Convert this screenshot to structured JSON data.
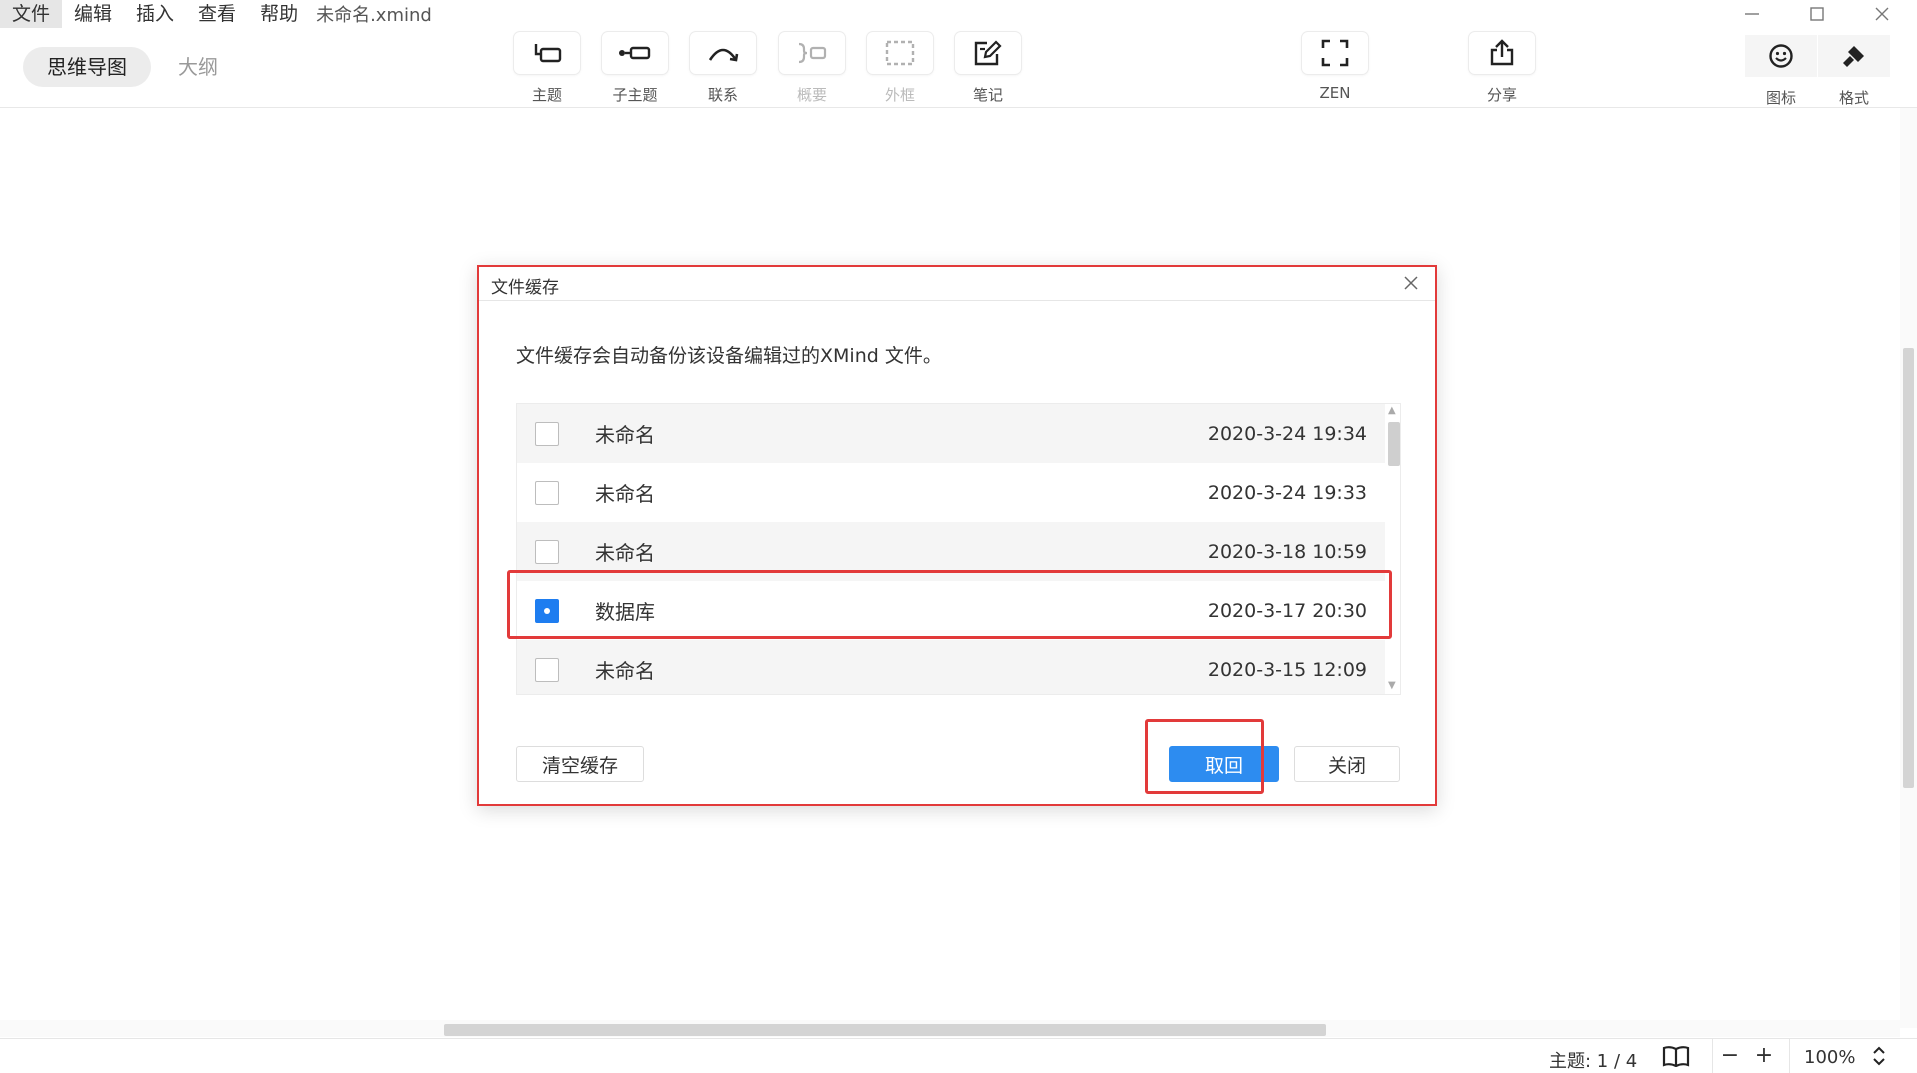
{
  "menubar": {
    "items": [
      "文件",
      "编辑",
      "插入",
      "查看",
      "帮助"
    ],
    "document_title": "未命名.xmind"
  },
  "view_tabs": {
    "mindmap": "思维导图",
    "outline": "大纲"
  },
  "toolbar": {
    "topic": "主题",
    "subtopic": "子主题",
    "relationship": "联系",
    "summary": "概要",
    "boundary": "外框",
    "notes": "笔记",
    "zen": "ZEN",
    "share": "分享",
    "icon": "图标",
    "format": "格式"
  },
  "dialog": {
    "title": "文件缓存",
    "description": "文件缓存会自动备份该设备编辑过的XMind 文件。",
    "rows": [
      {
        "name": "未命名",
        "date": "2020-3-24 19:34",
        "checked": false
      },
      {
        "name": "未命名",
        "date": "2020-3-24 19:33",
        "checked": false
      },
      {
        "name": "未命名",
        "date": "2020-3-18 10:59",
        "checked": false
      },
      {
        "name": "数据库",
        "date": "2020-3-17 20:30",
        "checked": true
      },
      {
        "name": "未命名",
        "date": "2020-3-15 12:09",
        "checked": false
      }
    ],
    "clear_button": "清空缓存",
    "restore_button": "取回",
    "close_button": "关闭"
  },
  "statusbar": {
    "topic_count": "主题: 1 / 4",
    "zoom": "100%"
  },
  "colors": {
    "accent": "#2d8cf0",
    "highlight": "#e23a3a"
  }
}
